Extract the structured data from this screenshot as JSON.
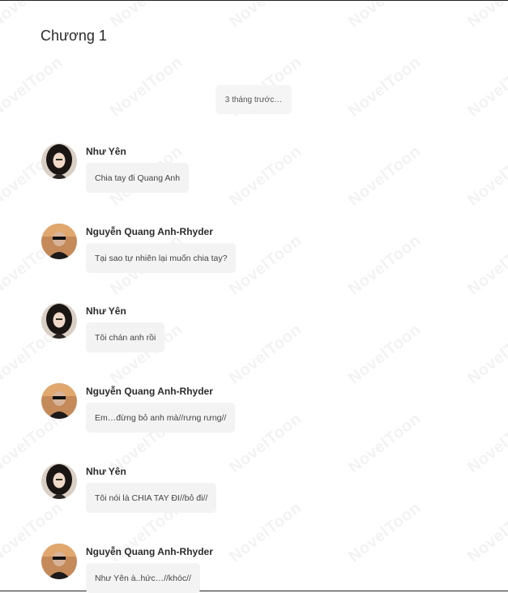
{
  "chapter_title": "Chương 1",
  "timestamp": "3 tháng trước…",
  "watermark_text": "NovelToon",
  "characters": {
    "yen": {
      "name": "Như Yên"
    },
    "anh": {
      "name": "Nguyễn Quang Anh-Rhyder"
    }
  },
  "messages": [
    {
      "sender": "Như Yên",
      "text": "Chia tay đi Quang Anh"
    },
    {
      "sender": "Nguyễn Quang Anh-Rhyder",
      "text": "Tại sao tự nhiên lại muốn chia tay?"
    },
    {
      "sender": "Như Yên",
      "text": "Tôi chán anh rồi"
    },
    {
      "sender": "Nguyễn Quang Anh-Rhyder",
      "text": "Em…đừng bỏ anh mà//rưng rưng//"
    },
    {
      "sender": "Như Yên",
      "text": "Tôi nói là CHIA TAY ĐI//bỏ đi//"
    },
    {
      "sender": "Nguyễn Quang Anh-Rhyder",
      "text": "Như Yên à..hức…//khóc//"
    }
  ]
}
